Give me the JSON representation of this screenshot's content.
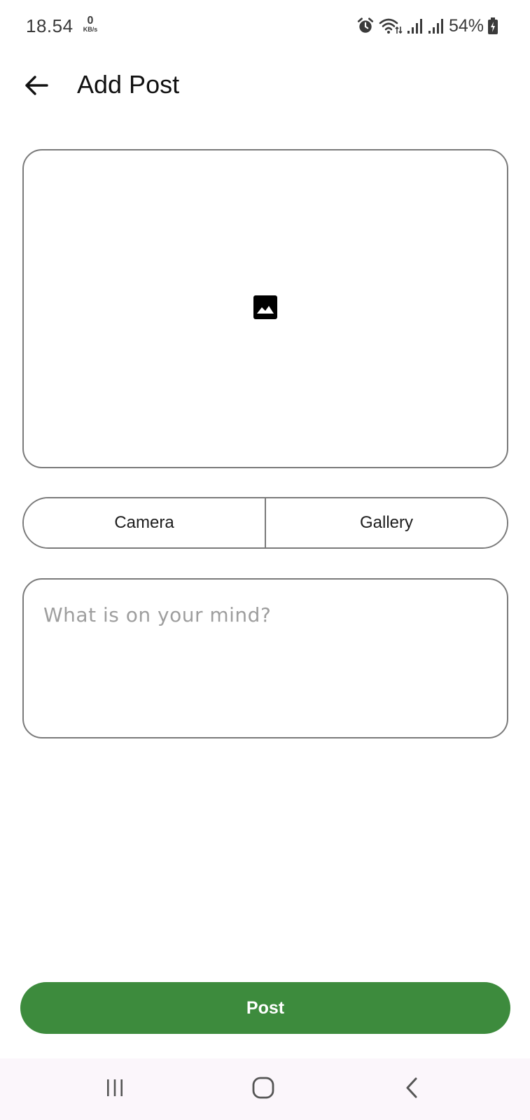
{
  "status_bar": {
    "time": "18.54",
    "net_speed_value": "0",
    "net_speed_unit": "KB/s",
    "battery_percent": "54%"
  },
  "header": {
    "title": "Add Post"
  },
  "media_buttons": {
    "camera_label": "Camera",
    "gallery_label": "Gallery"
  },
  "caption": {
    "placeholder": "What is on your mind?",
    "value": ""
  },
  "post_button": {
    "label": "Post"
  },
  "colors": {
    "accent": "#3d8b3d",
    "border": "#7a7a7a",
    "nav_background": "#fbf6fb"
  },
  "icons": {
    "back": "arrow-back-icon",
    "image_placeholder": "image-icon",
    "alarm": "alarm-icon",
    "wifi": "wifi-icon",
    "signal": "signal-icon",
    "battery": "battery-charging-icon",
    "nav_recents": "recents-icon",
    "nav_home": "home-icon",
    "nav_back": "nav-back-icon"
  }
}
